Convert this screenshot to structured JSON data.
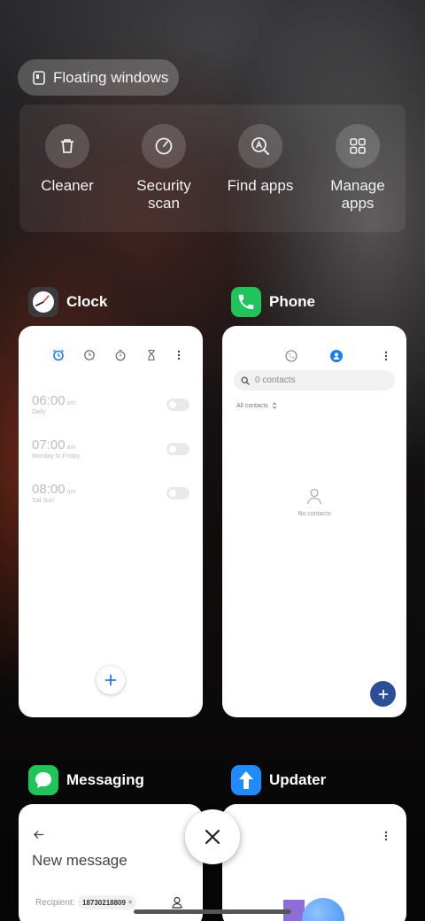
{
  "floating": {
    "label": "Floating windows"
  },
  "tools": [
    {
      "label": "Cleaner",
      "icon": "trash-icon"
    },
    {
      "label": "Security\nscan",
      "icon": "security-scan-icon"
    },
    {
      "label": "Find apps",
      "icon": "find-apps-icon"
    },
    {
      "label": "Manage\napps",
      "icon": "grid-icon"
    }
  ],
  "apps": {
    "clock": {
      "name": "Clock",
      "icon_color": "#3a3a3c",
      "alarms": [
        {
          "time": "06:00",
          "ampm": "am",
          "repeat": "Daily"
        },
        {
          "time": "07:00",
          "ampm": "am",
          "repeat": "Monday to Friday"
        },
        {
          "time": "08:00",
          "ampm": "am",
          "repeat": "Sat Sun"
        }
      ]
    },
    "phone": {
      "name": "Phone",
      "icon_color": "#1fc45b",
      "search_placeholder": "0 contacts",
      "filter": "All contacts",
      "empty": "No contacts",
      "accent": "#2b4e97"
    },
    "messaging": {
      "name": "Messaging",
      "icon_color": "#1fc45b",
      "title": "New message",
      "recipient_label": "Recipient:",
      "recipient_value": "18730218809"
    },
    "updater": {
      "name": "Updater",
      "icon_color": "#1e8bff"
    }
  }
}
